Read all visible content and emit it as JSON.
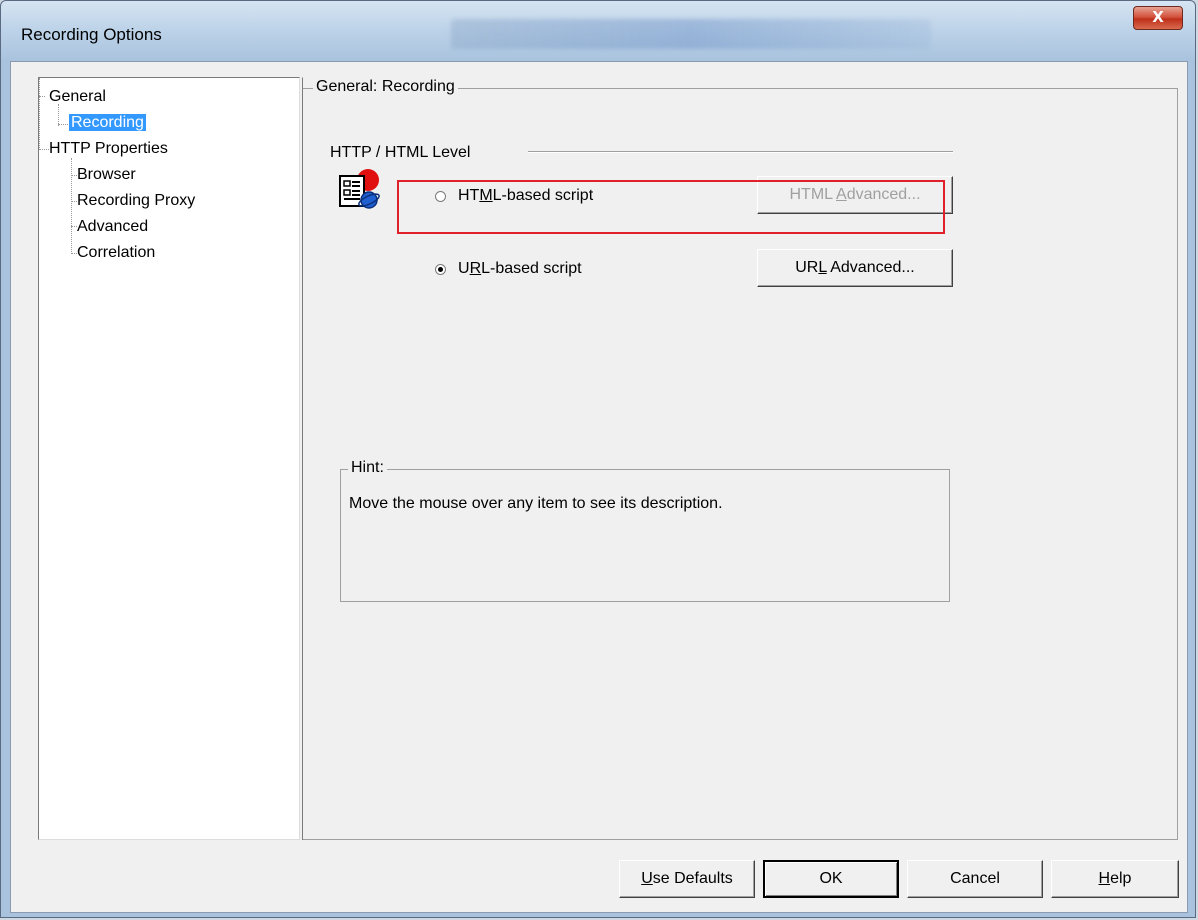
{
  "window": {
    "title": "Recording Options",
    "close_label": "X"
  },
  "tree": {
    "items": [
      {
        "label": "General"
      },
      {
        "label": "Recording"
      },
      {
        "label": "HTTP Properties"
      },
      {
        "label": "Browser"
      },
      {
        "label": "Recording Proxy"
      },
      {
        "label": "Advanced"
      },
      {
        "label": "Correlation"
      }
    ],
    "selected": "Recording"
  },
  "panel": {
    "group_title": "General: Recording",
    "section_title": "HTTP / HTML Level",
    "options": [
      {
        "label_pre": "HT",
        "label_u": "M",
        "label_post": "L-based script",
        "checked": false,
        "button_pre": "HTML ",
        "button_u": "A",
        "button_post": "dvanced...",
        "button_enabled": false
      },
      {
        "label_pre": "U",
        "label_u": "R",
        "label_post": "L-based script",
        "checked": true,
        "button_pre": "UR",
        "button_u": "L",
        "button_post": " Advanced...",
        "button_enabled": true
      }
    ],
    "hint": {
      "title": "Hint:",
      "text": "Move the mouse over any item to see its description."
    }
  },
  "footer": {
    "use_defaults_u": "U",
    "use_defaults_post": "se Defaults",
    "ok": "OK",
    "cancel": "Cancel",
    "help_u": "H",
    "help_post": "elp"
  },
  "colors": {
    "highlight": "#e0202a",
    "selection": "#3399ff"
  },
  "icons": [
    "app-recording-icon",
    "close-icon"
  ]
}
